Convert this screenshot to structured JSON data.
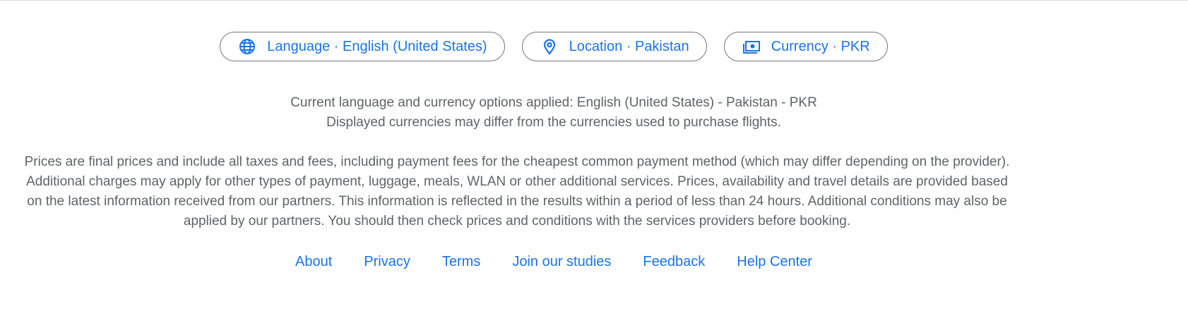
{
  "settings": {
    "language": {
      "label": "Language · English (United States)",
      "icon": "globe-icon"
    },
    "location": {
      "label": "Location · Pakistan",
      "icon": "location-pin-icon"
    },
    "currency": {
      "label": "Currency · PKR",
      "icon": "banknote-icon"
    }
  },
  "notice": {
    "applied": "Current language and currency options applied: English (United States) - Pakistan - PKR",
    "currency_note": "Displayed currencies may differ from the currencies used to purchase flights."
  },
  "disclaimer": "Prices are final prices and include all taxes and fees, including payment fees for the cheapest common payment method (which may differ depending on the provider). Additional charges may apply for other types of payment, luggage, meals, WLAN or other additional services. Prices, availability and travel details are provided based on the latest information received from our partners. This information is reflected in the results within a period of less than 24 hours. Additional conditions may also be applied by our partners. You should then check prices and conditions with the services providers before booking.",
  "footer_links": {
    "about": "About",
    "privacy": "Privacy",
    "terms": "Terms",
    "studies": "Join our studies",
    "feedback": "Feedback",
    "help": "Help Center"
  },
  "colors": {
    "link": "#1a73e8",
    "text": "#5f6368",
    "border": "#747775"
  }
}
